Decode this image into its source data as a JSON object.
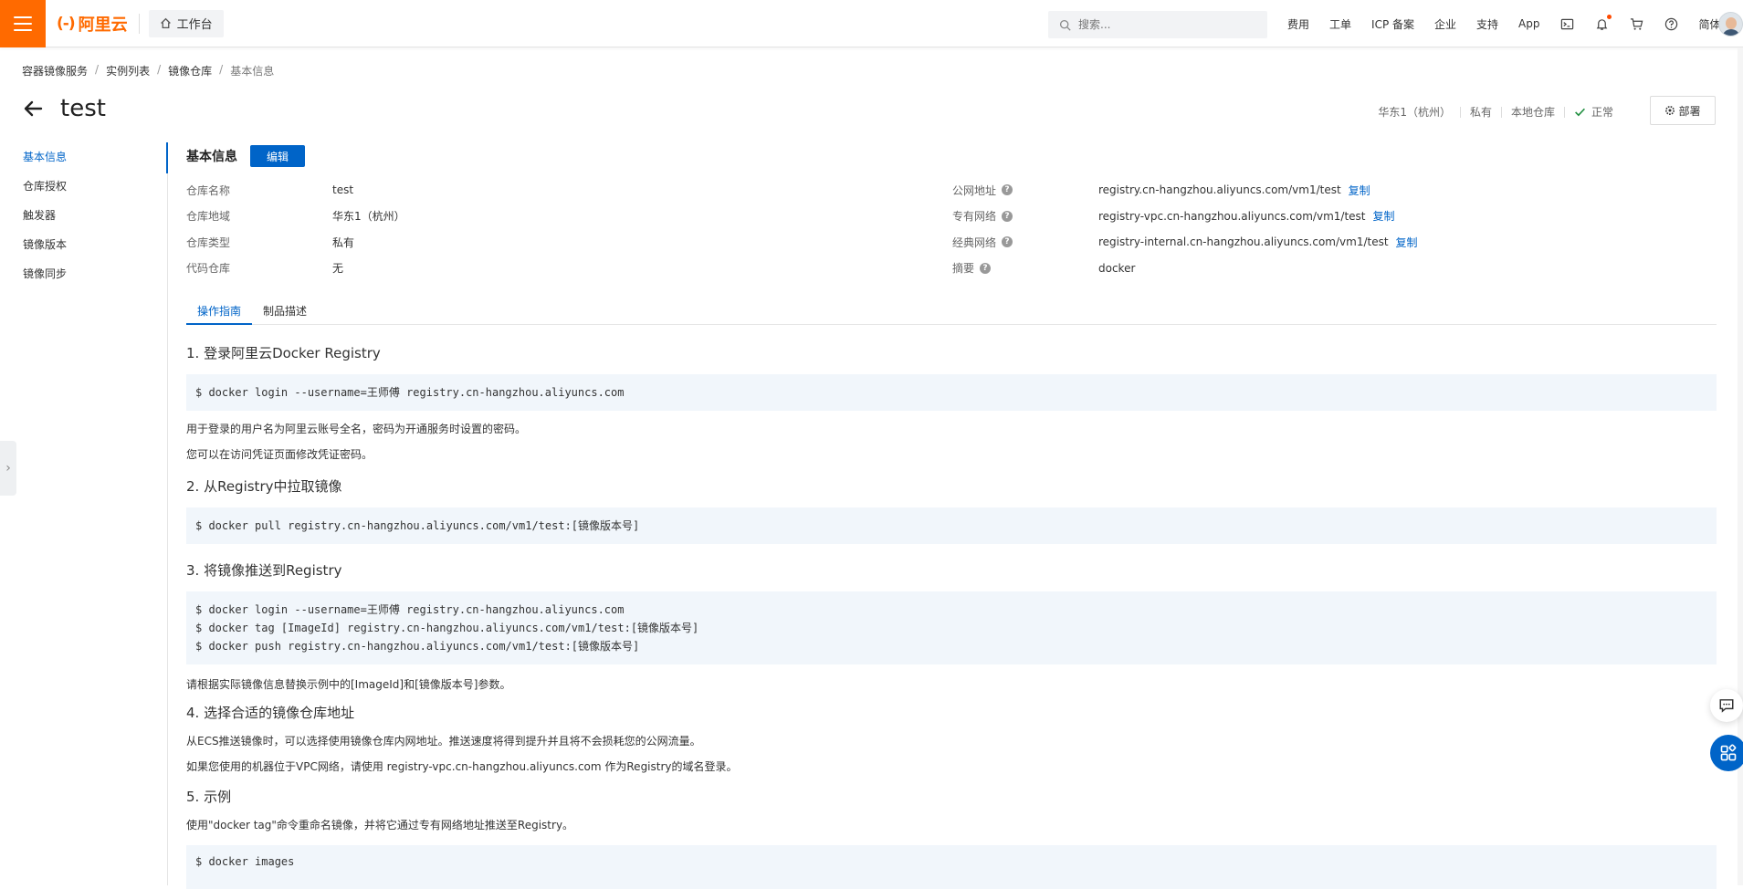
{
  "topbar": {
    "logo_mark": "(-)",
    "logo_text": "阿里云",
    "workbench": "工作台",
    "search_placeholder": "搜索...",
    "nav": [
      "费用",
      "工单",
      "ICP 备案",
      "企业",
      "支持",
      "App"
    ],
    "lang": "简体"
  },
  "breadcrumb": [
    "容器镜像服务",
    "实例列表",
    "镜像仓库",
    "基本信息"
  ],
  "page": {
    "title": "test",
    "region": "华东1（杭州）",
    "visibility": "私有",
    "repo_kind": "本地仓库",
    "status": "正常",
    "deploy": "部署"
  },
  "sidenav": {
    "items": [
      "基本信息",
      "仓库授权",
      "触发器",
      "镜像版本",
      "镜像同步"
    ],
    "active_index": 0
  },
  "info": {
    "section_title": "基本信息",
    "edit_label": "编辑",
    "left": [
      {
        "label": "仓库名称",
        "value": "test"
      },
      {
        "label": "仓库地域",
        "value": "华东1（杭州）"
      },
      {
        "label": "仓库类型",
        "value": "私有"
      },
      {
        "label": "代码仓库",
        "value": "无"
      }
    ],
    "right": [
      {
        "label": "公网地址",
        "value": "registry.cn-hangzhou.aliyuncs.com/vm1/test",
        "copy": "复制"
      },
      {
        "label": "专有网络",
        "value": "registry-vpc.cn-hangzhou.aliyuncs.com/vm1/test",
        "copy": "复制"
      },
      {
        "label": "经典网络",
        "value": "registry-internal.cn-hangzhou.aliyuncs.com/vm1/test",
        "copy": "复制"
      },
      {
        "label": "摘要",
        "value": "docker"
      }
    ]
  },
  "tabs": [
    "操作指南",
    "制品描述"
  ],
  "guide": {
    "s1_title": "1. 登录阿里云Docker Registry",
    "s1_code": [
      "$ docker login --username=王师傅 registry.cn-hangzhou.aliyuncs.com"
    ],
    "s1_notes": [
      "用于登录的用户名为阿里云账号全名，密码为开通服务时设置的密码。",
      "您可以在访问凭证页面修改凭证密码。"
    ],
    "s2_title": "2. 从Registry中拉取镜像",
    "s2_code": [
      "$ docker pull registry.cn-hangzhou.aliyuncs.com/vm1/test:[镜像版本号]"
    ],
    "s3_title": "3. 将镜像推送到Registry",
    "s3_code": [
      "$ docker login --username=王师傅 registry.cn-hangzhou.aliyuncs.com",
      "$ docker tag [ImageId] registry.cn-hangzhou.aliyuncs.com/vm1/test:[镜像版本号]",
      "$ docker push registry.cn-hangzhou.aliyuncs.com/vm1/test:[镜像版本号]"
    ],
    "s3_note": "请根据实际镜像信息替换示例中的[ImageId]和[镜像版本号]参数。",
    "s4_title": "4. 选择合适的镜像仓库地址",
    "s4_notes": [
      "从ECS推送镜像时，可以选择使用镜像仓库内网地址。推送速度将得到提升并且将不会损耗您的公网流量。",
      "如果您使用的机器位于VPC网络，请使用 registry-vpc.cn-hangzhou.aliyuncs.com 作为Registry的域名登录。"
    ],
    "s5_title": "5. 示例",
    "s5_note": "使用\"docker tag\"命令重命名镜像，并将它通过专有网络地址推送至Registry。",
    "s5_code": [
      "$ docker images"
    ]
  },
  "colors": {
    "brand": "#ff6a00",
    "primary": "#0064c8",
    "ok": "#1e8e3e"
  }
}
